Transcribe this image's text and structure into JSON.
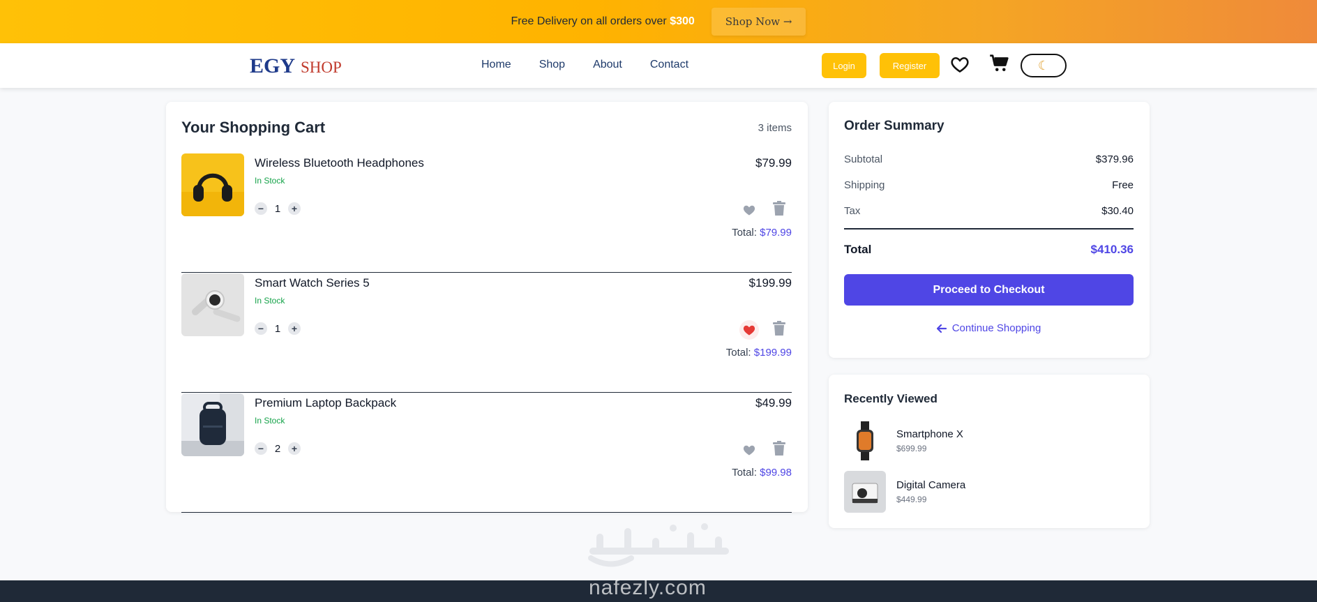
{
  "promo": {
    "text": "Free Delivery on all orders over",
    "amount": "$300",
    "cta": "Shop Now →"
  },
  "brand": {
    "egy": "EGY",
    "shop": "SHOP"
  },
  "nav": {
    "links": [
      "Home",
      "Shop",
      "About",
      "Contact"
    ],
    "login": "Login",
    "register": "Register",
    "icons": [
      "heart-icon",
      "cart-icon",
      "moon-icon"
    ]
  },
  "cart": {
    "title": "Your Shopping Cart",
    "count": "3 items",
    "total_label": "Total:",
    "items": [
      {
        "name": "Wireless Bluetooth Headphones",
        "stock": "In Stock",
        "qty": "1",
        "price": "$79.99",
        "total": "$79.99",
        "favorite": false
      },
      {
        "name": "Smart Watch Series 5",
        "stock": "In Stock",
        "qty": "1",
        "price": "$199.99",
        "total": "$199.99",
        "favorite": true
      },
      {
        "name": "Premium Laptop Backpack",
        "stock": "In Stock",
        "qty": "2",
        "price": "$49.99",
        "total": "$99.98",
        "favorite": false
      }
    ]
  },
  "summary": {
    "title": "Order Summary",
    "subtotal_label": "Subtotal",
    "subtotal": "$379.96",
    "shipping_label": "Shipping",
    "shipping": "Free",
    "tax_label": "Tax",
    "tax": "$30.40",
    "total_label": "Total",
    "total": "$410.36",
    "checkout": "Proceed to Checkout",
    "continue": "Continue Shopping"
  },
  "recent": {
    "title": "Recently Viewed",
    "items": [
      {
        "name": "Smartphone X",
        "price": "$699.99"
      },
      {
        "name": "Digital Camera",
        "price": "$449.99"
      }
    ]
  },
  "watermark": {
    "site": "nafezly.com"
  },
  "colors": {
    "accent": "#4f46e5",
    "promo": "#ffc107",
    "stock": "#16a34a",
    "favorite": "#e53935"
  }
}
